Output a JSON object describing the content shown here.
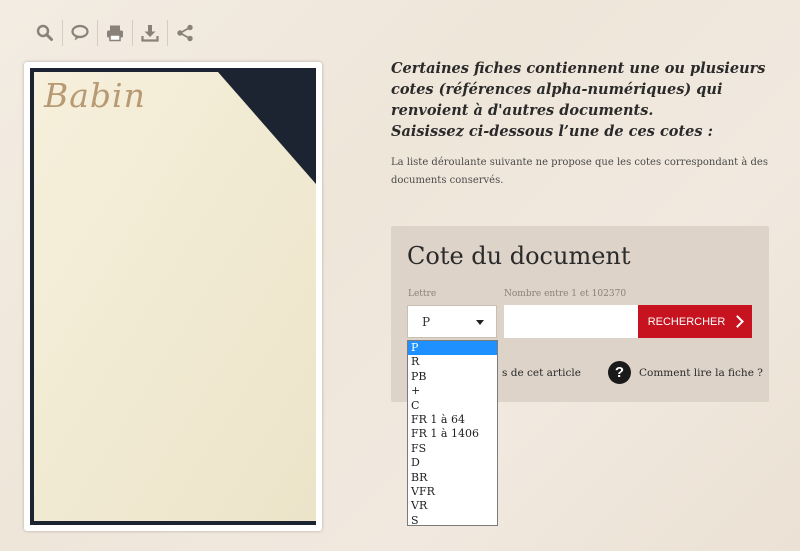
{
  "toolbar": {
    "icons": [
      "search-icon",
      "comment-icon",
      "print-icon",
      "download-icon",
      "share-icon"
    ]
  },
  "document_image": {
    "handwriting": "Babin"
  },
  "intro": {
    "line1": "Certaines fiches contiennent une ou plusieurs cotes (références alpha-numériques) qui renvoient à d'autres documents.",
    "line2": "Saisissez ci-dessous l’une de ces cotes :"
  },
  "note": "La liste déroulante suivante ne propose que les cotes correspondant à des documents conservés.",
  "panel": {
    "title": "Cote du document",
    "letter_label": "Lettre",
    "number_label": "Nombre entre 1 et 102370",
    "selected_letter": "P",
    "number_value": "",
    "search_button": "RECHERCHER",
    "article_link_partial": "s de cet article",
    "help_link": "Comment lire la fiche ?"
  },
  "dropdown_options": [
    "P",
    "R",
    "PB",
    "+",
    "C",
    "FR 1 à 64",
    "FR 1 à 1406",
    "FS",
    "D",
    "BR",
    "VFR",
    "VR",
    "S"
  ],
  "colors": {
    "accent_red": "#c6131f",
    "panel_bg": "#ddd3c8",
    "selection_blue": "#1e90ff"
  }
}
